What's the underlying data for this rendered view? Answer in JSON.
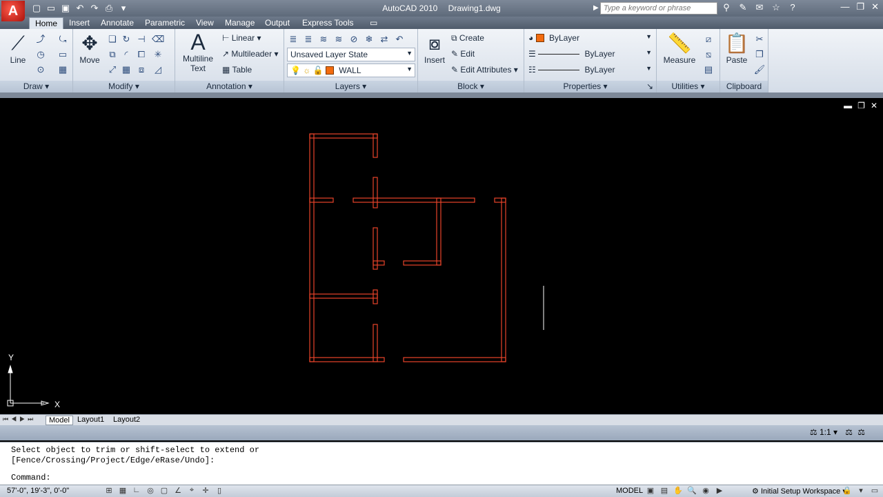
{
  "window": {
    "app_name": "AutoCAD 2010",
    "document": "Drawing1.dwg",
    "app_button_letter": "A",
    "search_placeholder": "Type a keyword or phrase"
  },
  "ribbon_tabs": [
    "Home",
    "Insert",
    "Annotate",
    "Parametric",
    "View",
    "Manage",
    "Output",
    "Express Tools"
  ],
  "ribbon": {
    "draw": {
      "title": "Draw",
      "line_label": "Line"
    },
    "modify": {
      "title": "Modify",
      "move_label": "Move"
    },
    "annotation": {
      "title": "Annotation",
      "multiline_label": "Multiline",
      "text_label": "Text",
      "linear_label": "Linear",
      "multileader_label": "Multileader",
      "table_label": "Table"
    },
    "layers": {
      "title": "Layers",
      "layer_state": "Unsaved Layer State",
      "current_layer": "WALL"
    },
    "block": {
      "title": "Block",
      "insert_label": "Insert",
      "create_label": "Create",
      "edit_label": "Edit",
      "edit_attributes_label": "Edit Attributes"
    },
    "properties": {
      "title": "Properties",
      "color": "ByLayer",
      "linetype": "ByLayer",
      "lineweight": "ByLayer"
    },
    "utilities": {
      "title": "Utilities",
      "measure_label": "Measure"
    },
    "clipboard": {
      "title": "Clipboard",
      "paste_label": "Paste"
    }
  },
  "layout_tabs": {
    "model": "Model",
    "layout1": "Layout1",
    "layout2": "Layout2"
  },
  "ucs": {
    "x": "X",
    "y": "Y"
  },
  "annotation_scale": "1:1",
  "command": {
    "line1": "Select object to trim or shift-select to extend or",
    "line2": "[Fence/Crossing/Project/Edge/eRase/Undo]:",
    "prompt": "Command:"
  },
  "status": {
    "coordinates": "57'-0\", 19'-3\", 0'-0\"",
    "space": "MODEL",
    "workspace": "Initial Setup Workspace"
  },
  "colors": {
    "wall": "#e8442a",
    "layer_swatch": "#f26b0f",
    "canvas": "#000000"
  }
}
